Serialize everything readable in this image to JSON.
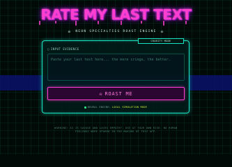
{
  "header": {
    "title": "RATE MY LAST TEXT",
    "subtitle": "NEON SPECIALTIES ROAST ENGINE"
  },
  "icons": {
    "subtitle_left": "skull-icon",
    "subtitle_right": "skull-icon",
    "input_label": "message-icon",
    "roast_button": "skull-icon",
    "status": "status-dot-icon"
  },
  "panel": {
    "badge": "CHARITY MODE",
    "input_label": "INPUT EVIDENCE",
    "input_placeholder": "Paste your last text here... the more cringe, the better.",
    "button_label": "ROAST ME",
    "status_prefix": "NEURAL ENGINE:",
    "status_value": "LOCAL SIMULATION MODE"
  },
  "footer": {
    "disclaimer": "WARNING: AI IS SAVAGE AND LACKS EMPATHY. USE AT YOUR OWN RISK. NO HUMAN FEELINGS WERE SPARED IN THE MAKING OF THIS APP."
  },
  "colors": {
    "background": "#020a08",
    "accent_pink": "#ff3ecf",
    "accent_cyan": "#19e2c2",
    "status_yellow": "#e8ff3a",
    "band_blue": "#09126a"
  }
}
